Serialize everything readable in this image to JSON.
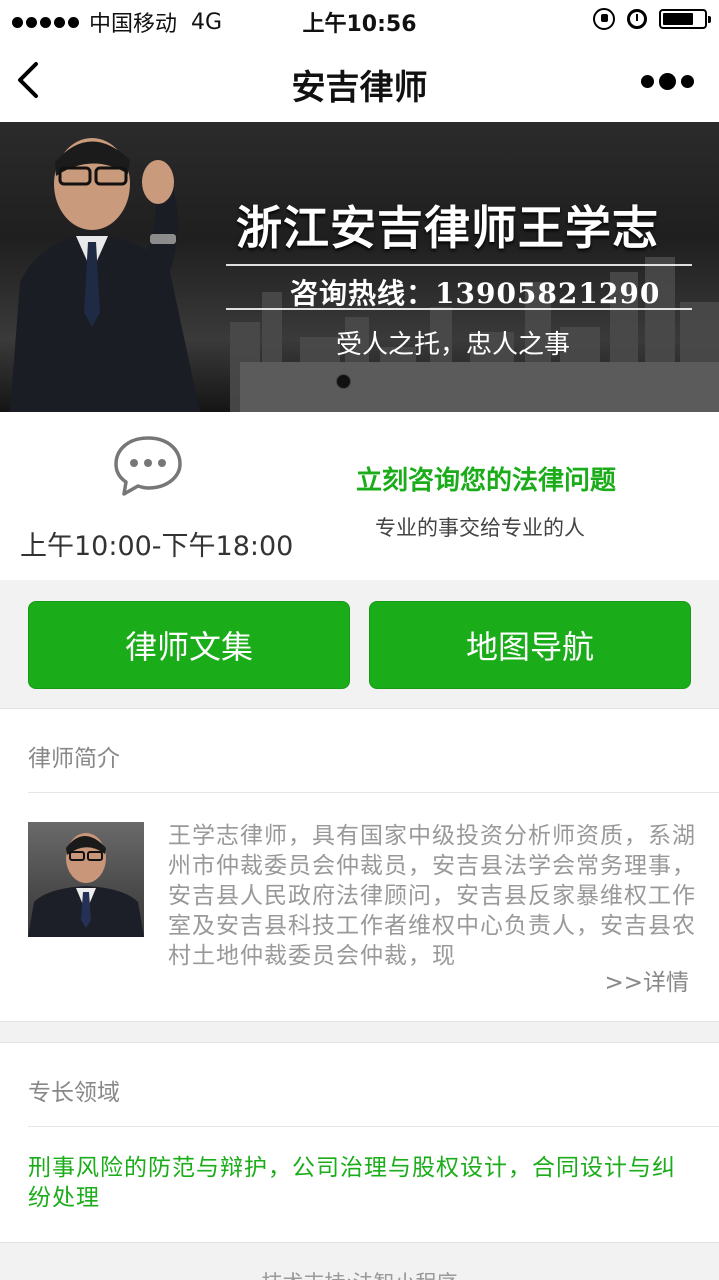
{
  "status_bar": {
    "carrier": "中国移动",
    "network": "4G",
    "time": "上午10:56",
    "battery_level": 0.75
  },
  "nav": {
    "title": "安吉律师"
  },
  "banner": {
    "title": "浙江安吉律师王学志",
    "hotline": "咨询热线：13905821290",
    "slogan": "受人之托，忠人之事"
  },
  "consult": {
    "hours": "上午10:00-下午18:00",
    "title": "立刻咨询您的法律问题",
    "subtitle": "专业的事交给专业的人"
  },
  "buttons": {
    "articles": "律师文集",
    "map": "地图导航"
  },
  "intro": {
    "header": "律师简介",
    "text": "王学志律师，具有国家中级投资分析师资质，系湖州市仲裁委员会仲裁员，安吉县法学会常务理事，安吉县人民政府法律顾问，安吉县反家暴维权工作室及安吉县科技工作者维权中心负责人，安吉县农村土地仲裁委员会仲裁，现",
    "more": ">>详情"
  },
  "specialty": {
    "header": "专长领域",
    "text": "刑事风险的防范与辩护，公司治理与股权设计，合同设计与纠纷处理"
  },
  "footer": {
    "text": "技术支持:法智小程序"
  },
  "colors": {
    "accent_green": "#1aad19"
  }
}
